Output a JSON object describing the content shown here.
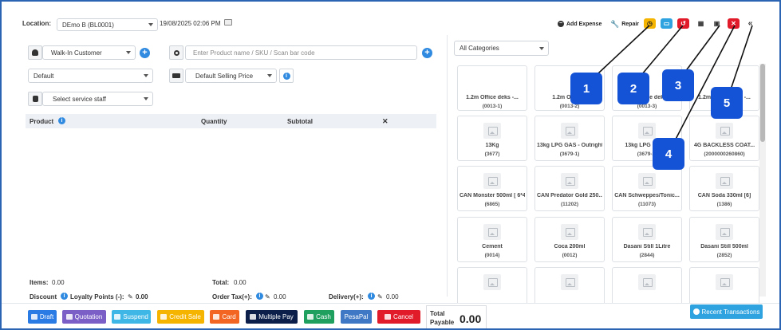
{
  "header": {
    "location_label": "Location:",
    "location_value": "DEmo B (BL0001)",
    "datetime": "19/08/2025 02:06 PM",
    "add_expense": "Add Expense",
    "repair": "Repair"
  },
  "customer": {
    "value": "Walk-In Customer"
  },
  "price_group": {
    "value": "Default"
  },
  "service_staff": {
    "value": "Select service staff"
  },
  "search": {
    "placeholder": "Enter Product name / SKU / Scan bar code"
  },
  "selling_price": {
    "value": "Default Selling Price"
  },
  "table": {
    "col_product": "Product",
    "col_quantity": "Quantity",
    "col_subtotal": "Subtotal",
    "col_remove": "✕"
  },
  "summary": {
    "items_label": "Items:",
    "items_value": "0.00",
    "total_label": "Total:",
    "total_value": "0.00",
    "discount_label": "Discount",
    "loyalty_label": "Loyalty Points (-):",
    "loyalty_value": "0.00",
    "order_tax_label": "Order Tax(+):",
    "order_tax_value": "0.00",
    "delivery_label": "Delivery(+):",
    "delivery_value": "0.00"
  },
  "category_filter": {
    "value": "All Categories"
  },
  "products": [
    {
      "name": "1.2m Office deks -...",
      "sku": "(0013-1)",
      "image": false
    },
    {
      "name": "1.2m Office...",
      "sku": "(0013-2)",
      "image": false
    },
    {
      "name": "1.2m Office deks...",
      "sku": "(0013-3)",
      "image": false
    },
    {
      "name": "1.2m Office deks -...",
      "sku": "(0013-4)",
      "image": false
    },
    {
      "name": "13Kg",
      "sku": "(3677)",
      "image": true
    },
    {
      "name": "13kg LPG GAS - Outright",
      "sku": "(3679-1)",
      "image": true
    },
    {
      "name": "13kg LPG GAS...",
      "sku": "(3679-2)",
      "image": true
    },
    {
      "name": "4G BACKLESS COAT...",
      "sku": "(2000000260860)",
      "image": true
    },
    {
      "name": "CAN Monster 500ml [ 6*4]",
      "sku": "(6865)",
      "image": true
    },
    {
      "name": "CAN Predator Gold 250...",
      "sku": "(11202)",
      "image": true
    },
    {
      "name": "CAN Schweppes/Tonic...",
      "sku": "(11073)",
      "image": true
    },
    {
      "name": "CAN Soda 330ml [6]",
      "sku": "(1386)",
      "image": true
    },
    {
      "name": "Cement",
      "sku": "(0014)",
      "image": true
    },
    {
      "name": "Coca 200ml",
      "sku": "(0012)",
      "image": true
    },
    {
      "name": "Dasani Still 1Litre",
      "sku": "(2844)",
      "image": true
    },
    {
      "name": "Dasani Still 500ml",
      "sku": "(2852)",
      "image": true
    },
    {
      "name": "",
      "sku": "",
      "image": true
    },
    {
      "name": "",
      "sku": "",
      "image": true
    },
    {
      "name": "",
      "sku": "",
      "image": true
    },
    {
      "name": "",
      "sku": "",
      "image": true
    }
  ],
  "badges": [
    "1",
    "2",
    "3",
    "4",
    "5"
  ],
  "footer": {
    "draft": "Draft",
    "quotation": "Quotation",
    "suspend": "Suspend",
    "credit_sale": "Credit Sale",
    "card": "Card",
    "multiple_pay": "Multiple Pay",
    "cash": "Cash",
    "pesapal": "PesaPal",
    "cancel": "Cancel",
    "total_payable_label": "Total Payable",
    "total_payable_value": "0.00",
    "recent_transactions": "Recent Transactions"
  },
  "colors": {
    "draft": "#2a7be4",
    "quotation": "#7b5fc7",
    "suspend": "#3fb7e6",
    "credit_sale": "#f5b400",
    "card": "#f26522",
    "multiple_pay": "#0b1f4a",
    "cash": "#1fa05f",
    "pesapal": "#3f78c4",
    "cancel": "#e21b2b",
    "badge": "#1553d6",
    "recent": "#2ea3e0"
  }
}
